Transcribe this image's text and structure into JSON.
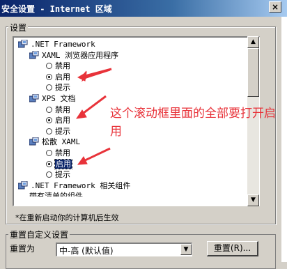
{
  "window": {
    "title": "安全设置 - Internet 区域",
    "close_glyph": "×"
  },
  "group": {
    "label": "设置"
  },
  "tree": [
    {
      "kind": "category",
      "label": ".NET Framework",
      "icon": "settings-category-icon"
    },
    {
      "kind": "category",
      "label": "XAML 浏览器应用程序",
      "icon": "settings-category-icon"
    },
    {
      "kind": "radio",
      "label": "禁用",
      "checked": false
    },
    {
      "kind": "radio",
      "label": "启用",
      "checked": true
    },
    {
      "kind": "radio",
      "label": "提示",
      "checked": false
    },
    {
      "kind": "category",
      "label": "XPS 文档",
      "icon": "settings-category-icon"
    },
    {
      "kind": "radio",
      "label": "禁用",
      "checked": false
    },
    {
      "kind": "radio",
      "label": "启用",
      "checked": true
    },
    {
      "kind": "radio",
      "label": "提示",
      "checked": false
    },
    {
      "kind": "category",
      "label": "松散 XAML",
      "icon": "settings-category-icon"
    },
    {
      "kind": "radio",
      "label": "禁用",
      "checked": false
    },
    {
      "kind": "radio",
      "label": "启用",
      "checked": true,
      "selected": true
    },
    {
      "kind": "radio",
      "label": "提示",
      "checked": false
    },
    {
      "kind": "category",
      "label": ".NET Framework 相关组件",
      "icon": "settings-category-icon"
    },
    {
      "kind": "partial",
      "label": "带有清单的组件..."
    }
  ],
  "footnote": "*在重新启动你的计算机后生效",
  "reset": {
    "group_label": "重置自定义设置",
    "reset_to_label": "重置为",
    "select_value": "中-高 (默认值)",
    "button_label": "重置(R)..."
  },
  "annotation": {
    "text": "这个滚动框里面的全部要打开启用",
    "color": "#e8333a"
  }
}
